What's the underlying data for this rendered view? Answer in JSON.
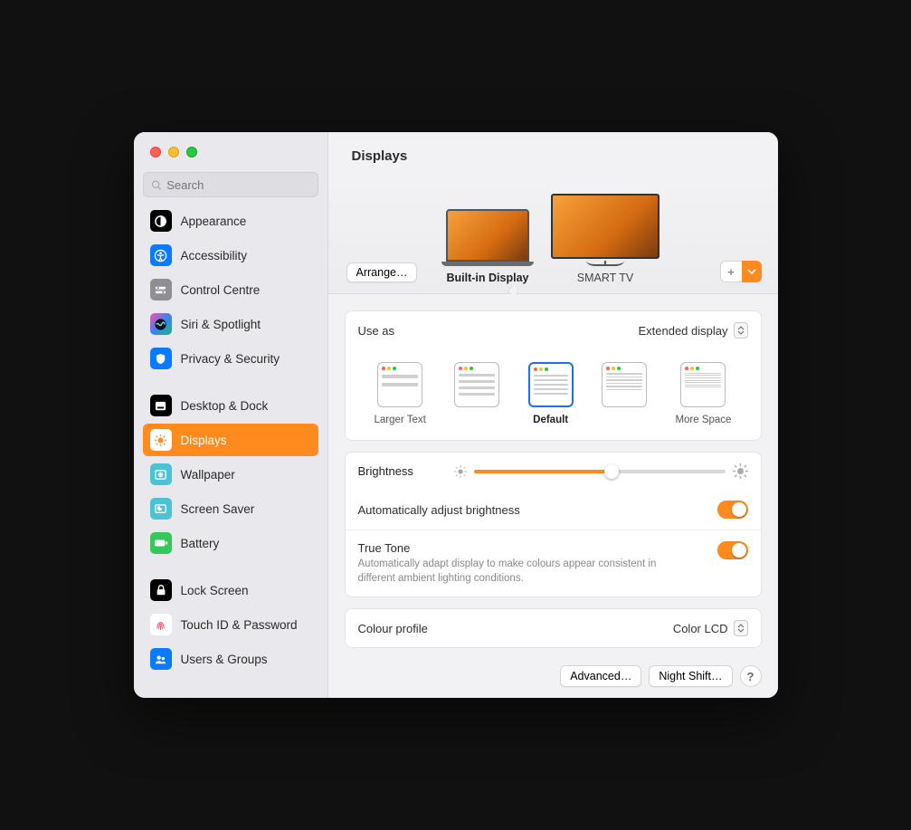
{
  "window": {
    "title": "Displays"
  },
  "search": {
    "placeholder": "Search"
  },
  "sidebar": {
    "groups": [
      [
        {
          "label": "Appearance",
          "icon": "appearance-icon",
          "ic": "ic-bw"
        },
        {
          "label": "Accessibility",
          "icon": "accessibility-icon",
          "ic": "ic-blue"
        },
        {
          "label": "Control Centre",
          "icon": "control-centre-icon",
          "ic": "ic-gray"
        },
        {
          "label": "Siri & Spotlight",
          "icon": "siri-icon",
          "ic": "ic-rainbow"
        },
        {
          "label": "Privacy & Security",
          "icon": "privacy-icon",
          "ic": "ic-blue"
        }
      ],
      [
        {
          "label": "Desktop & Dock",
          "icon": "dock-icon",
          "ic": "ic-bw"
        },
        {
          "label": "Displays",
          "icon": "displays-icon",
          "ic": "ic-blue",
          "selected": true
        },
        {
          "label": "Wallpaper",
          "icon": "wallpaper-icon",
          "ic": "ic-teal"
        },
        {
          "label": "Screen Saver",
          "icon": "screensaver-icon",
          "ic": "ic-teal"
        },
        {
          "label": "Battery",
          "icon": "battery-icon",
          "ic": "ic-green"
        }
      ],
      [
        {
          "label": "Lock Screen",
          "icon": "lock-icon",
          "ic": "ic-bw"
        },
        {
          "label": "Touch ID & Password",
          "icon": "touchid-icon",
          "ic": "ic-white"
        },
        {
          "label": "Users & Groups",
          "icon": "users-icon",
          "ic": "ic-blue"
        }
      ]
    ]
  },
  "displays": {
    "arrange_label": "Arrange…",
    "items": [
      {
        "name": "Built-in Display",
        "active": true
      },
      {
        "name": "SMART TV",
        "active": false
      }
    ]
  },
  "use_as": {
    "label": "Use as",
    "value": "Extended display"
  },
  "resolutions": {
    "items": [
      {
        "label": "Larger Text"
      },
      {
        "label": ""
      },
      {
        "label": "Default",
        "selected": true,
        "bold": true
      },
      {
        "label": ""
      },
      {
        "label": "More Space"
      }
    ]
  },
  "brightness": {
    "label": "Brightness",
    "percent": 55
  },
  "auto_brightness": {
    "label": "Automatically adjust brightness",
    "on": true
  },
  "true_tone": {
    "label": "True Tone",
    "desc": "Automatically adapt display to make colours appear consistent in different ambient lighting conditions.",
    "on": true
  },
  "colour_profile": {
    "label": "Colour profile",
    "value": "Color LCD"
  },
  "footer": {
    "advanced": "Advanced…",
    "night_shift": "Night Shift…",
    "help": "?"
  }
}
